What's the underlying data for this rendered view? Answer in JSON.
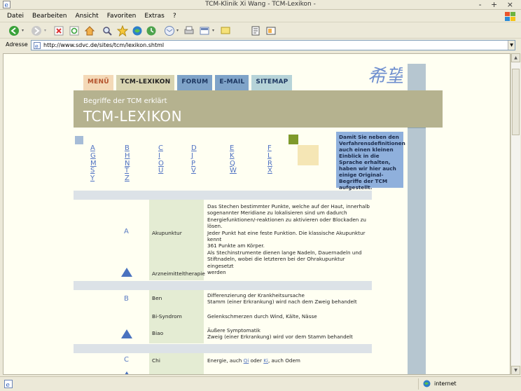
{
  "window": {
    "title": "TCM-Klinik Xi Wang - TCM-Lexikon -",
    "buttons": "- + ×"
  },
  "menu": {
    "items": [
      "Datei",
      "Bearbeiten",
      "Ansicht",
      "Favoriten",
      "Extras",
      "?"
    ]
  },
  "address": {
    "label": "Adresse",
    "url": "http://www.sdvc.de/sites/tcm/lexikon.shtml"
  },
  "status": {
    "zone": "internet"
  },
  "page": {
    "nav": {
      "menu": "MENÜ",
      "lexikon": "TCM-LEXIKON",
      "forum": "FORUM",
      "email": "E-MAIL",
      "sitemap": "SITEMAP"
    },
    "banner": {
      "subtitle": "Begriffe der TCM erklärt",
      "title": "TCM-LEXIKON"
    },
    "logo_text": "希望",
    "alphabet_columns": [
      [
        "A",
        "G",
        "M",
        "S",
        "Y"
      ],
      [
        "B",
        "H",
        "N",
        "T",
        "Z"
      ],
      [
        "C",
        "I",
        "O",
        "U"
      ],
      [
        "D",
        "J",
        "P",
        "V"
      ],
      [
        "E",
        "K",
        "Q",
        "W"
      ],
      [
        "F",
        "L",
        "R",
        "X"
      ]
    ],
    "info": "Damit Sie neben den Verfahrensdefinitionen auch einen kleinen Einblick in die Sprache erhalten, haben wir hier auch einige Original-Begriffe der TCM aufgestellt.",
    "sections": {
      "A": {
        "letter": "A",
        "akupunktur": {
          "term": "Akupunktur",
          "def": [
            "Das Stechen bestimmter Punkte, welche auf der Haut, innerhalb",
            "sogenannter Meridiane zu lokalisieren sind um dadurch",
            "Energiefunktionen/-reaktionen zu aktivieren oder Blockaden zu",
            "lösen.",
            "Jeder Punkt hat eine feste Funktion. Die klassische Akupunktur kennt",
            "361 Punkte am Körper.",
            "Als Stechinstrumente dienen lange Nadeln, Dauernadeln und",
            "Stiftnadeln, wobei die letzteren bei der Ohrakupunktur eingesetzt",
            "werden"
          ]
        },
        "arznei": {
          "term": "Arzneimitteltherapie"
        }
      },
      "B": {
        "letter": "B",
        "ben": {
          "term": "Ben",
          "def": [
            "Differenzierung der Krankheitsursache",
            "Stamm (einer Erkrankung) wird nach dem Zweig behandelt"
          ]
        },
        "bi": {
          "term": "Bi-Syndrom",
          "def": [
            "Gelenkschmerzen durch Wind, Kälte, Nässe"
          ]
        },
        "biao": {
          "term": "Biao",
          "def": [
            "Äußere Symptomatik",
            "Zweig (einer Erkrankung) wird vor dem Stamm behandelt"
          ]
        }
      },
      "C": {
        "letter": "C",
        "chi": {
          "term": "Chi",
          "def_pre": "Energie, auch ",
          "link1": "Qi",
          "def_mid": " oder ",
          "link2": "Ki",
          "def_post": ", auch Odem"
        }
      }
    }
  }
}
